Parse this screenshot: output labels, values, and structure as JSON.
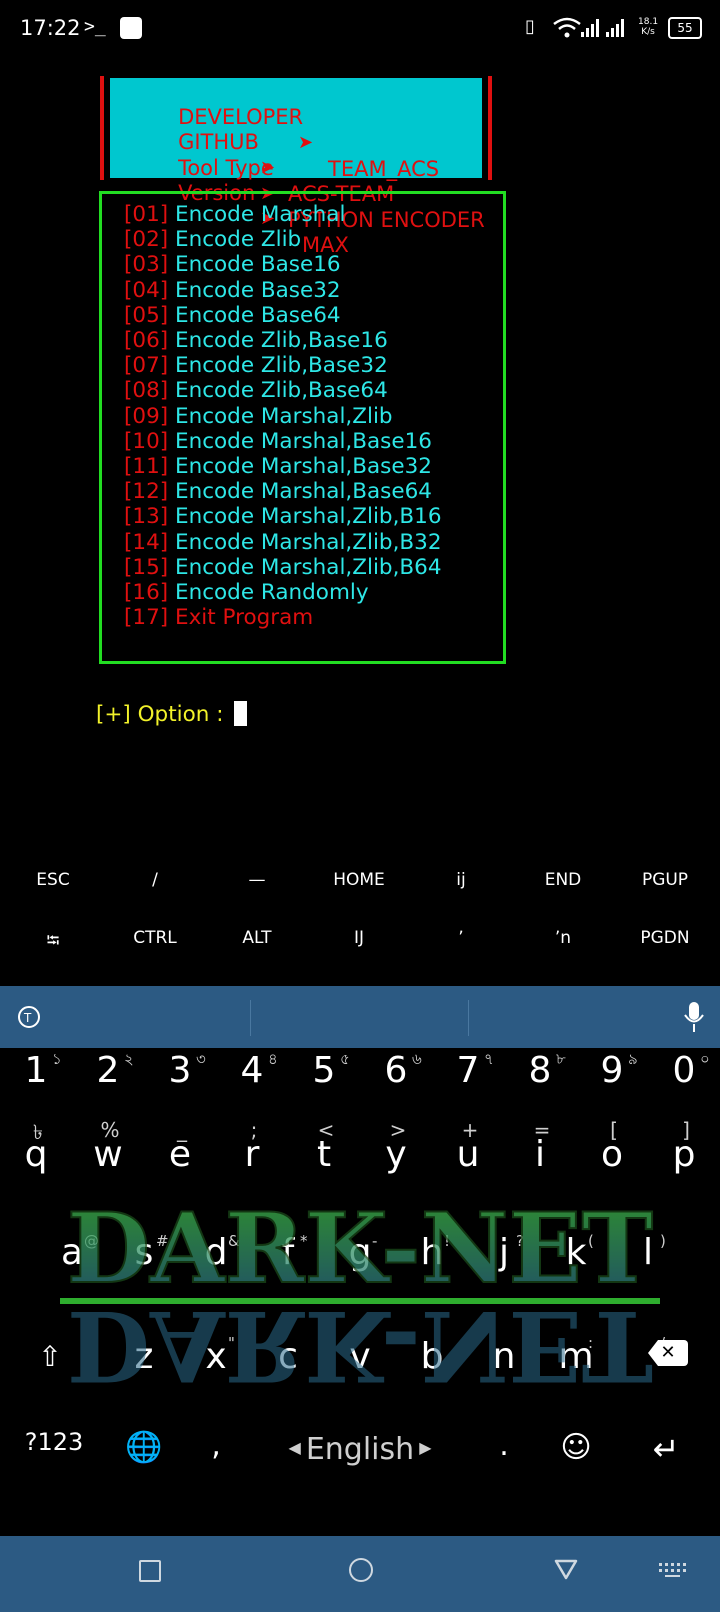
{
  "status": {
    "time": "17:22",
    "prompt_icon": "terminal-prompt-icon",
    "notif_icon": "notification-square-icon",
    "net_speed_value": "18.1",
    "net_speed_unit": "K/s",
    "battery": "55"
  },
  "banner": {
    "rows": [
      {
        "key": "DEVELOPER",
        "value": "TEAM_ACS"
      },
      {
        "key": "GITHUB",
        "value": "ACS-TEAM"
      },
      {
        "key": "Tool Type",
        "value": "PYTHON ENCODER"
      },
      {
        "key": "Version",
        "value": "MAX"
      }
    ]
  },
  "menu": {
    "items": [
      {
        "num": "01",
        "label": "Encode Marshal"
      },
      {
        "num": "02",
        "label": "Encode Zlib"
      },
      {
        "num": "03",
        "label": "Encode Base16"
      },
      {
        "num": "04",
        "label": "Encode Base32"
      },
      {
        "num": "05",
        "label": "Encode Base64"
      },
      {
        "num": "06",
        "label": "Encode Zlib,Base16"
      },
      {
        "num": "07",
        "label": "Encode Zlib,Base32"
      },
      {
        "num": "08",
        "label": "Encode Zlib,Base64"
      },
      {
        "num": "09",
        "label": "Encode Marshal,Zlib"
      },
      {
        "num": "10",
        "label": "Encode Marshal,Base16"
      },
      {
        "num": "11",
        "label": "Encode Marshal,Base32"
      },
      {
        "num": "12",
        "label": "Encode Marshal,Base64"
      },
      {
        "num": "13",
        "label": "Encode Marshal,Zlib,B16"
      },
      {
        "num": "14",
        "label": "Encode Marshal,Zlib,B32"
      },
      {
        "num": "15",
        "label": "Encode Marshal,Zlib,B64"
      },
      {
        "num": "16",
        "label": "Encode Randomly"
      },
      {
        "num": "17",
        "label": "Exit Program"
      }
    ]
  },
  "prompt": "[+] Option : ",
  "extra_keys": {
    "row1": [
      "ESC",
      "/",
      "—",
      "HOME",
      "ij",
      "END",
      "PGUP"
    ],
    "row2": [
      "⭾",
      "CTRL",
      "ALT",
      "IJ",
      "ʼ",
      "ʼn",
      "PGDN"
    ]
  },
  "keyboard": {
    "numbers": [
      "1",
      "2",
      "3",
      "4",
      "5",
      "6",
      "7",
      "8",
      "9",
      "0"
    ],
    "number_hints": [
      "১",
      "২",
      "৩",
      "৪",
      "৫",
      "৬",
      "৭",
      "৮",
      "৯",
      "০"
    ],
    "symbols": [
      "৳",
      "%",
      "_",
      ";",
      "<",
      ">",
      "+",
      "=",
      "[",
      "]"
    ],
    "row_q": [
      "q",
      "w",
      "e",
      "r",
      "t",
      "y",
      "u",
      "i",
      "o",
      "p"
    ],
    "row_a": [
      "a",
      "s",
      "d",
      "f",
      "g",
      "h",
      "j",
      "k",
      "l"
    ],
    "row_a_hints": [
      "@",
      "#",
      "&",
      "*",
      "-",
      "!",
      "?",
      "(",
      ")"
    ],
    "row_z": [
      "z",
      "x",
      "c",
      "v",
      "b",
      "n",
      "m"
    ],
    "row_z_hints": [
      "",
      "\"",
      "",
      "",
      "",
      "",
      ":",
      "/"
    ],
    "sym_key": "?123",
    "space_label": "English",
    "comma": ",",
    "period": ".",
    "watermark": "DARK-NET",
    "colors": {
      "suggest_bar": "#2c5a83",
      "watermark": "#2faa2f"
    }
  },
  "colors": {
    "banner_bg": "#00c7cf",
    "accent_red": "#e01010",
    "menu_text": "#2ee7e7",
    "menu_border": "#22dd22",
    "prompt": "#f2f22a"
  }
}
